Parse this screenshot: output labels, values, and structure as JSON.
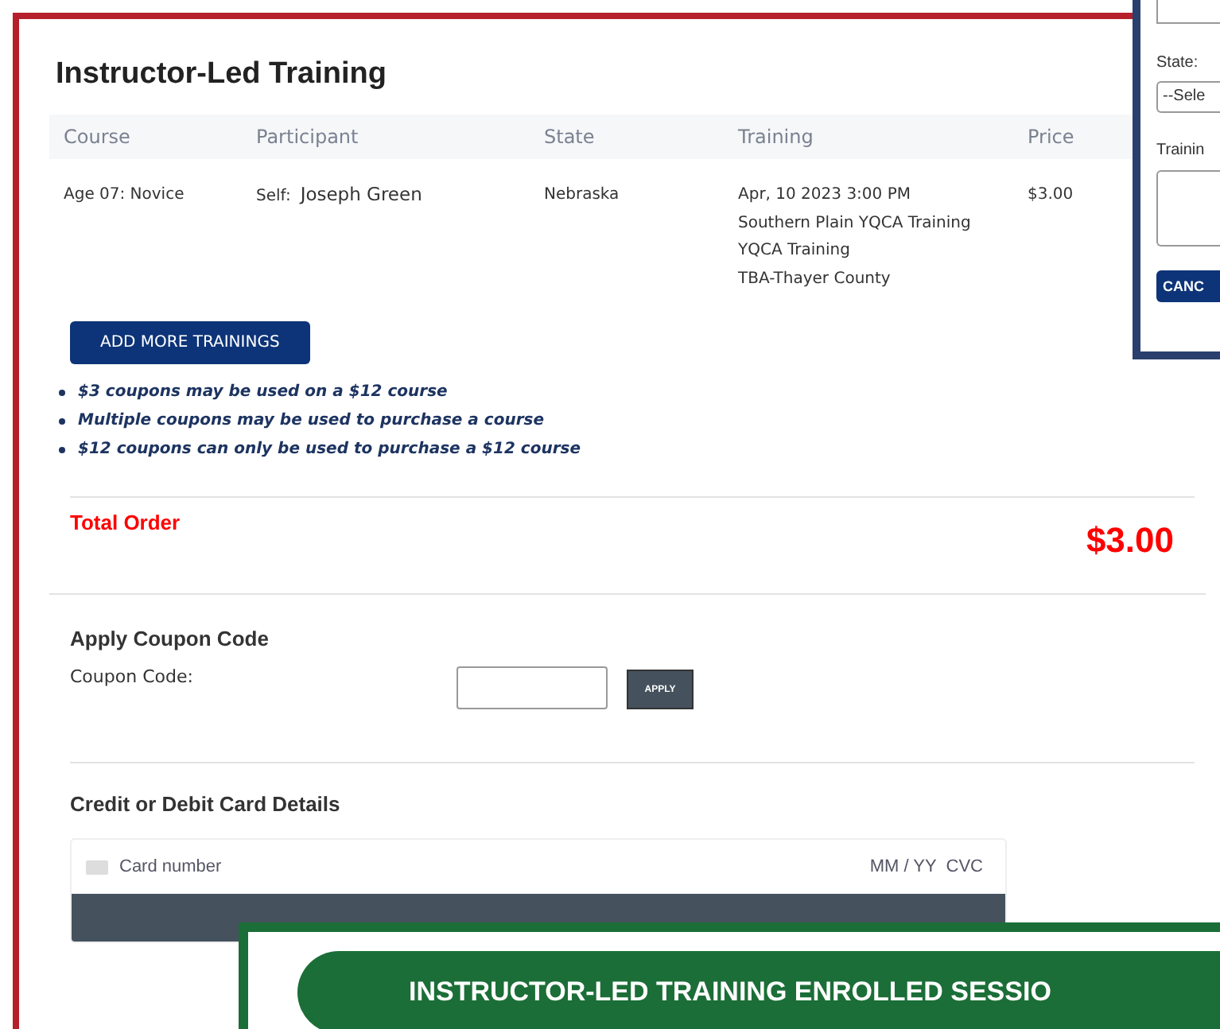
{
  "page": {
    "title": "Instructor-Led Training",
    "table": {
      "columns": [
        "Course",
        "Participant",
        "State",
        "Training",
        "Price"
      ],
      "rows": [
        {
          "course": "Age 07: Novice",
          "participant_label": "Self:",
          "participant_name": "Joseph Green",
          "state": "Nebraska",
          "training": [
            "Apr, 10 2023 3:00 PM",
            "Southern Plain YQCA Training",
            "YQCA Training",
            "TBA-Thayer County"
          ],
          "price": "$3.00"
        }
      ]
    },
    "add_button": "ADD MORE TRAININGS",
    "notes": [
      "$3 coupons may be used on a $12 course",
      "Multiple coupons may be used to purchase a course",
      "$12 coupons can only be used to purchase a $12 course"
    ],
    "total": {
      "label": "Total Order",
      "amount": "$3.00"
    },
    "coupon": {
      "heading": "Apply Coupon Code",
      "label": "Coupon Code:",
      "button": "APPLY"
    },
    "card": {
      "heading": "Credit or Debit Card Details",
      "placeholder": "Card number",
      "expiry_cvc": "MM / YY  CVC"
    }
  },
  "side_panel": {
    "state_label": "State:",
    "state_select": "--Sele",
    "training_label": "Trainin",
    "cancel_button": "CANC"
  },
  "banner": {
    "title": "INSTRUCTOR-LED TRAINING ENROLLED SESSIO"
  }
}
